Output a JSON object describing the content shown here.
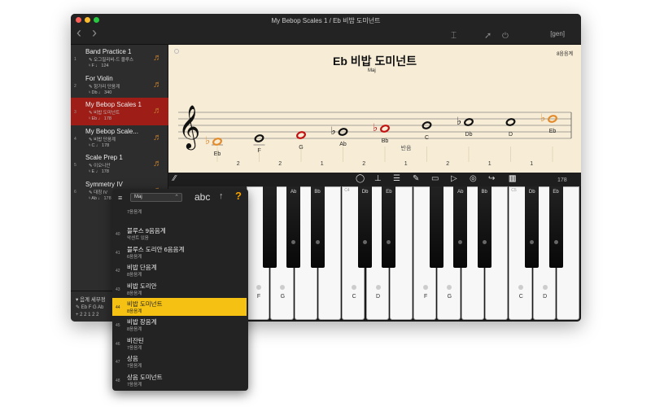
{
  "window": {
    "title": "My Bebop Scales 1 / Eb 비밥 도미넌트",
    "gen_label": "[gen]"
  },
  "sidebar": {
    "songs": [
      {
        "num": "1",
        "name": "Band Practice 1",
        "sub": "오그질리비-드 블루스",
        "key": "F",
        "tempo": "124"
      },
      {
        "num": "2",
        "name": "For Violin",
        "sub": "헝가리 단음계",
        "key": "Db",
        "tempo": "340"
      },
      {
        "num": "3",
        "name": "My Bebop Scales 1",
        "sub": "비밥 도미넌트",
        "key": "Eb",
        "tempo": "178"
      },
      {
        "num": "4",
        "name": "My Bebop Scale...",
        "sub": "비밥 단음계",
        "key": "C",
        "tempo": "178"
      },
      {
        "num": "5",
        "name": "Scale Prep 1",
        "sub": "이오니안",
        "key": "E",
        "tempo": "178"
      },
      {
        "num": "6",
        "name": "Symmetry IV",
        "sub": "대칭 IV",
        "key": "Ab",
        "tempo": "178"
      }
    ],
    "scale_details": "음계 세부정",
    "scale_notes": "Eb F G Ab",
    "scale_intervals": "2 2 1 2 2"
  },
  "sheet": {
    "title": "Eb 비밥 도미넌트",
    "chord": "Maj",
    "note_count": "8음음계",
    "semitone_label": "반음",
    "notes": [
      "Eb",
      "F",
      "G",
      "Ab",
      "Bb",
      "C",
      "Db",
      "D",
      "Eb"
    ],
    "intervals": [
      "2",
      "2",
      "1",
      "2",
      "1",
      "2",
      "1",
      "1"
    ],
    "note_colors": [
      "#e38b2a",
      "#111",
      "#c01010",
      "#111",
      "#c01010",
      "#111",
      "#111",
      "#111",
      "#e38b2a"
    ]
  },
  "toolbar": {
    "tempo": "178"
  },
  "piano": {
    "white_keys": [
      "F",
      "G",
      "A",
      "B",
      "C",
      "D",
      "E",
      "F",
      "G",
      "A",
      "B",
      "C",
      "D",
      "E"
    ],
    "white_labels": [
      "F",
      "G",
      "",
      "",
      "C",
      "D",
      "",
      "F",
      "G",
      "",
      "",
      "C",
      "D",
      ""
    ],
    "octave_labels": [
      "",
      "",
      "",
      "",
      "C4",
      "",
      "",
      "",
      "",
      "",
      "",
      "C5",
      "",
      ""
    ],
    "black_keys": [
      "Gb",
      "Ab",
      "Bb",
      "Db",
      "Eb",
      "Gb",
      "Ab",
      "Bb",
      "Db",
      "Eb"
    ],
    "black_labels": [
      "",
      "Ab",
      "Bb",
      "Db",
      "Eb",
      "",
      "Ab",
      "Bb",
      "Db",
      "Eb"
    ],
    "colors": {
      "root": "#e38b2a",
      "guide": "#c01010",
      "accent": "#f5c113"
    }
  },
  "popup": {
    "dropdown": "Maj",
    "abc": "abc",
    "help": "?",
    "items": [
      {
        "num": "",
        "name": "",
        "sub": "7음음계"
      },
      {
        "num": "40",
        "name": "블루스 9음음계",
        "sub": "악센트 있음"
      },
      {
        "num": "41",
        "name": "블루스 도리안 6음음계",
        "sub": "6음음계"
      },
      {
        "num": "42",
        "name": "비밥 단음계",
        "sub": "8음음계"
      },
      {
        "num": "43",
        "name": "비밥 도리안",
        "sub": "8음음계"
      },
      {
        "num": "44",
        "name": "비밥 도미넌트",
        "sub": "8음음계"
      },
      {
        "num": "45",
        "name": "비밥 장음계",
        "sub": "8음음계"
      },
      {
        "num": "46",
        "name": "비잔틴",
        "sub": "7음음계"
      },
      {
        "num": "47",
        "name": "상음",
        "sub": "7음음계"
      },
      {
        "num": "48",
        "name": "상음 도미넌트",
        "sub": "7음음계"
      },
      {
        "num": "",
        "name": "서스펜디드 5음음계",
        "sub": ""
      }
    ]
  }
}
